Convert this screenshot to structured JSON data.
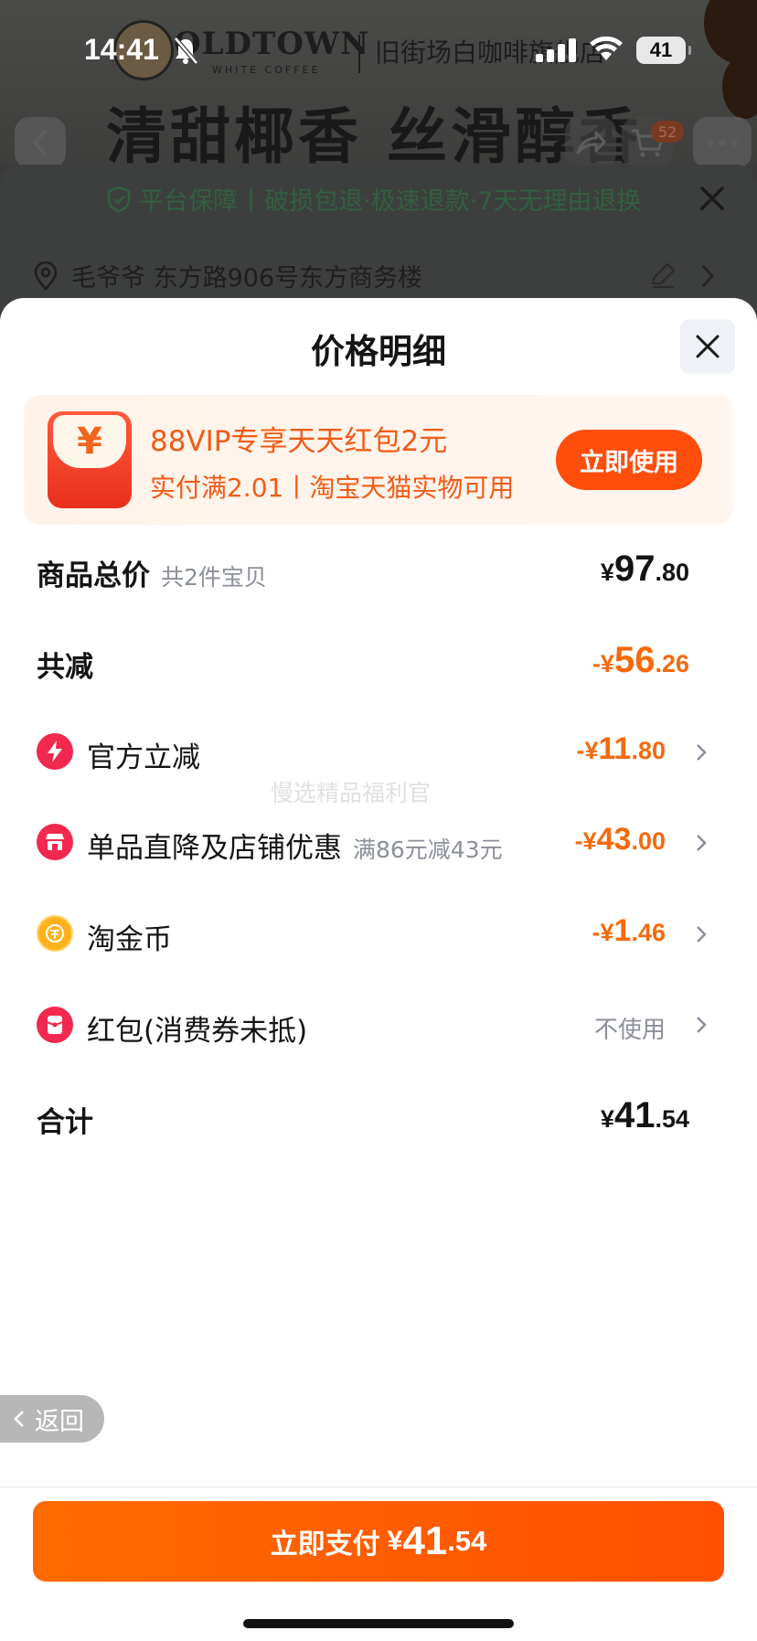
{
  "status_bar": {
    "time": "14:41",
    "battery": "41"
  },
  "background": {
    "brand": "OLDTOWN",
    "brand_sub": "WHITE COFFEE",
    "brand_cn": "旧街场白咖啡旗舰店",
    "slogan": "清甜椰香 丝滑醇香",
    "cart_count": "52",
    "guarantee": {
      "title": "平台保障",
      "detail": "破损包退·极速退款·7天无理由退换"
    },
    "address": "毛爷爷 东方路906号东方商务楼"
  },
  "sheet": {
    "title": "价格明细",
    "promo": {
      "title": "88VIP专享天天红包2元",
      "subtitle": "实付满2.01丨淘宝天猫实物可用",
      "button": "立即使用",
      "icon_glyph": "¥"
    },
    "rows": {
      "total": {
        "label": "商品总价",
        "note": "共2件宝贝",
        "cur": "¥",
        "int": "97",
        "dec": ".80"
      },
      "reduce": {
        "label": "共减",
        "cur": "-¥",
        "int": "56",
        "dec": ".26"
      },
      "official": {
        "label": "官方立减",
        "cur": "-¥",
        "int": "11",
        "dec": ".80"
      },
      "shop": {
        "label": "单品直降及店铺优惠",
        "note": "满86元减43元",
        "cur": "-¥",
        "int": "43",
        "dec": ".00"
      },
      "coin": {
        "label": "淘金币",
        "cur": "-¥",
        "int": "1",
        "dec": ".46"
      },
      "redpacket": {
        "label": "红包(消费券未抵)",
        "value": "不使用"
      },
      "sum": {
        "label": "合计",
        "cur": "¥",
        "int": "41",
        "dec": ".54"
      }
    },
    "watermark": "慢选精品福利官",
    "back": "返回",
    "pay": {
      "label": "立即支付",
      "cur": "¥",
      "int": "41",
      "dec": ".54"
    }
  },
  "colors": {
    "accent_orange": "#f56a0d",
    "pay_button": "#ff5a00",
    "promo_button": "#ff4d0c",
    "promo_bg": "#fff3e9"
  }
}
